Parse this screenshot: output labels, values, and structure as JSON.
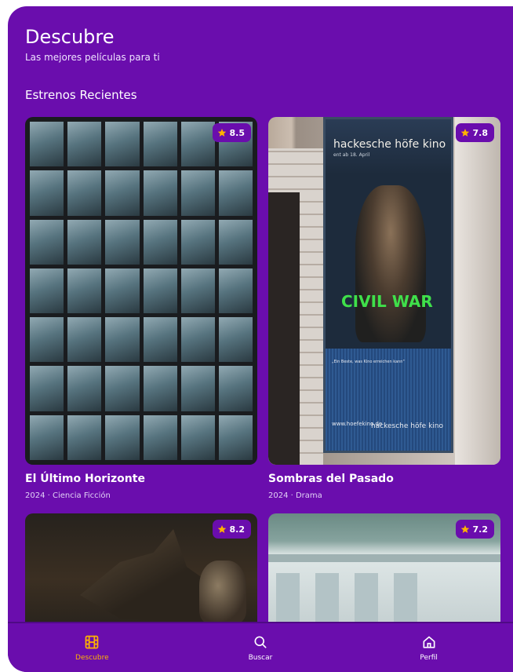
{
  "app": {
    "title": "Descubre",
    "subtitle": "Las mejores películas para ti",
    "accent": "#6a0dad",
    "active_color": "#ffb300"
  },
  "section": {
    "title": "Estrenos Recientes"
  },
  "movies": [
    {
      "title": "El Último Horizonte",
      "meta": "2024 · Ciencia Ficción",
      "rating": "8.5",
      "poster_caption": ""
    },
    {
      "title": "Sombras del Pasado",
      "meta": "2024 · Drama",
      "rating": "7.8",
      "poster_text": {
        "brand": "hackesche höfe kino",
        "date": "ent ab 18. April",
        "headline": "CIVIL WAR",
        "quote": "„Ein Beste, was Kino erreichen kann\"",
        "url": "www.hoefekino.de",
        "logo": "hackesche höfe kino"
      }
    },
    {
      "title": "",
      "meta": "",
      "rating": "8.2"
    },
    {
      "title": "",
      "meta": "",
      "rating": "7.2"
    }
  ],
  "nav": {
    "items": [
      {
        "label": "Descubre",
        "icon": "film-icon",
        "active": true
      },
      {
        "label": "Buscar",
        "icon": "search-icon",
        "active": false
      },
      {
        "label": "Perfil",
        "icon": "home-icon",
        "active": false
      }
    ]
  }
}
